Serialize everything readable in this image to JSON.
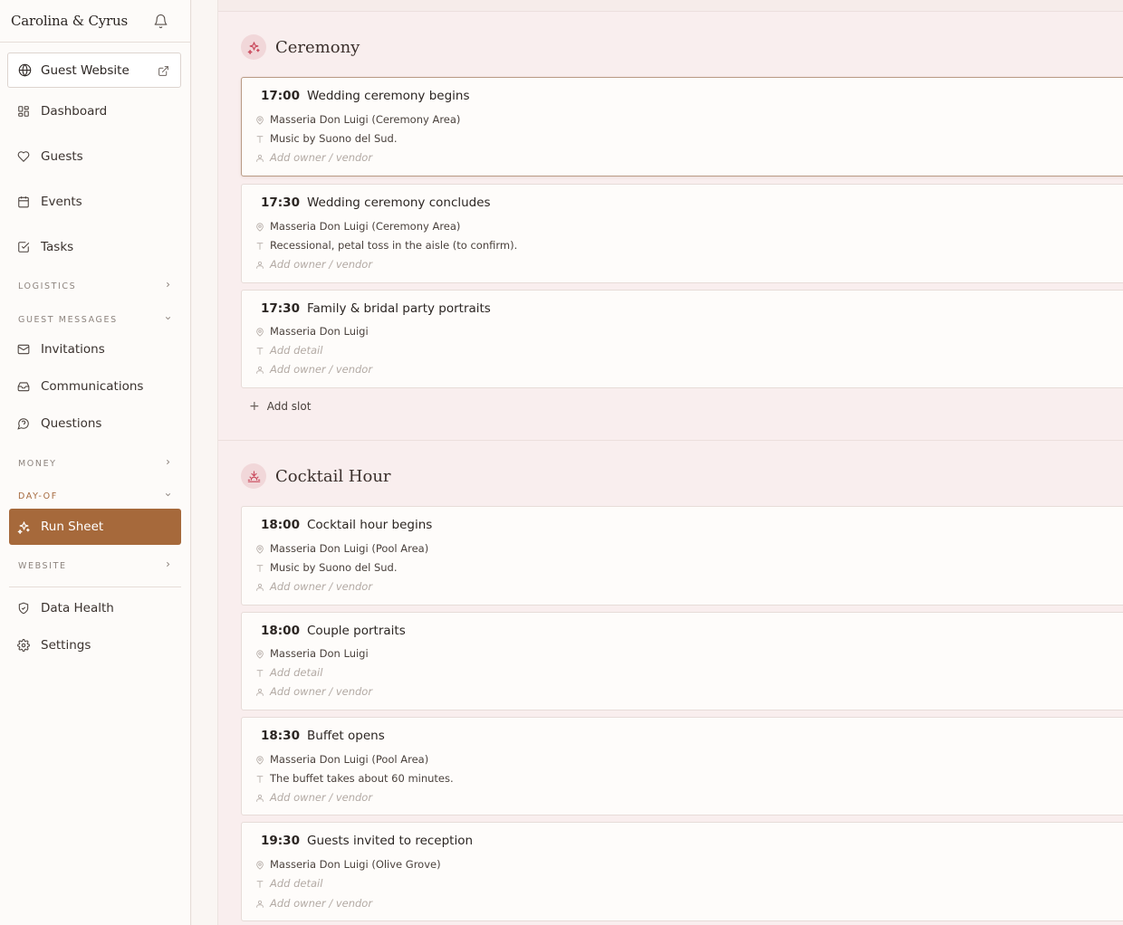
{
  "sidebar": {
    "brand": "Carolina & Cyrus",
    "guest_website": "Guest Website",
    "nav_top": [
      "Dashboard",
      "Guests",
      "Events",
      "Tasks"
    ],
    "logistics": "LOGISTICS",
    "guest_messages": "GUEST MESSAGES",
    "messages_items": [
      "Invitations",
      "Communications",
      "Questions"
    ],
    "money": "MONEY",
    "day_of": "DAY-OF",
    "run_sheet": "Run Sheet",
    "website": "WEBSITE",
    "data_health": "Data Health",
    "settings": "Settings"
  },
  "sections": [
    {
      "name": "Ceremony",
      "slots": [
        {
          "time": "17:00",
          "title": "Wedding ceremony begins",
          "location": "Masseria Don Luigi (Ceremony Area)",
          "detail": "Music by Suono del Sud.",
          "detail_placeholder": false,
          "owner": "Add owner / vendor"
        },
        {
          "time": "17:30",
          "title": "Wedding ceremony concludes",
          "location": "Masseria Don Luigi (Ceremony Area)",
          "detail": "Recessional, petal toss in the aisle (to confirm).",
          "detail_placeholder": false,
          "owner": "Add owner / vendor"
        },
        {
          "time": "17:30",
          "title": "Family & bridal party portraits",
          "location": "Masseria Don Luigi",
          "detail": "Add detail",
          "detail_placeholder": true,
          "owner": "Add owner / vendor"
        }
      ],
      "add_slot": "Add slot"
    },
    {
      "name": "Cocktail Hour",
      "slots": [
        {
          "time": "18:00",
          "title": "Cocktail hour begins",
          "location": "Masseria Don Luigi (Pool Area)",
          "detail": "Music by Suono del Sud.",
          "detail_placeholder": false,
          "owner": "Add owner / vendor"
        },
        {
          "time": "18:00",
          "title": "Couple portraits",
          "location": "Masseria Don Luigi",
          "detail": "Add detail",
          "detail_placeholder": true,
          "owner": "Add owner / vendor"
        },
        {
          "time": "18:30",
          "title": "Buffet opens",
          "location": "Masseria Don Luigi (Pool Area)",
          "detail": "The buffet takes about 60 minutes.",
          "detail_placeholder": false,
          "owner": "Add owner / vendor"
        },
        {
          "time": "19:30",
          "title": "Guests invited to reception",
          "location": "Masseria Don Luigi (Olive Grove)",
          "detail": "Add detail",
          "detail_placeholder": true,
          "owner": "Add owner / vendor"
        }
      ]
    }
  ],
  "colors": {
    "accent": "#a6693b",
    "section_bg": "#f9eeee",
    "badge": "#f1d7d9",
    "badge_icon": "#c9485b"
  }
}
